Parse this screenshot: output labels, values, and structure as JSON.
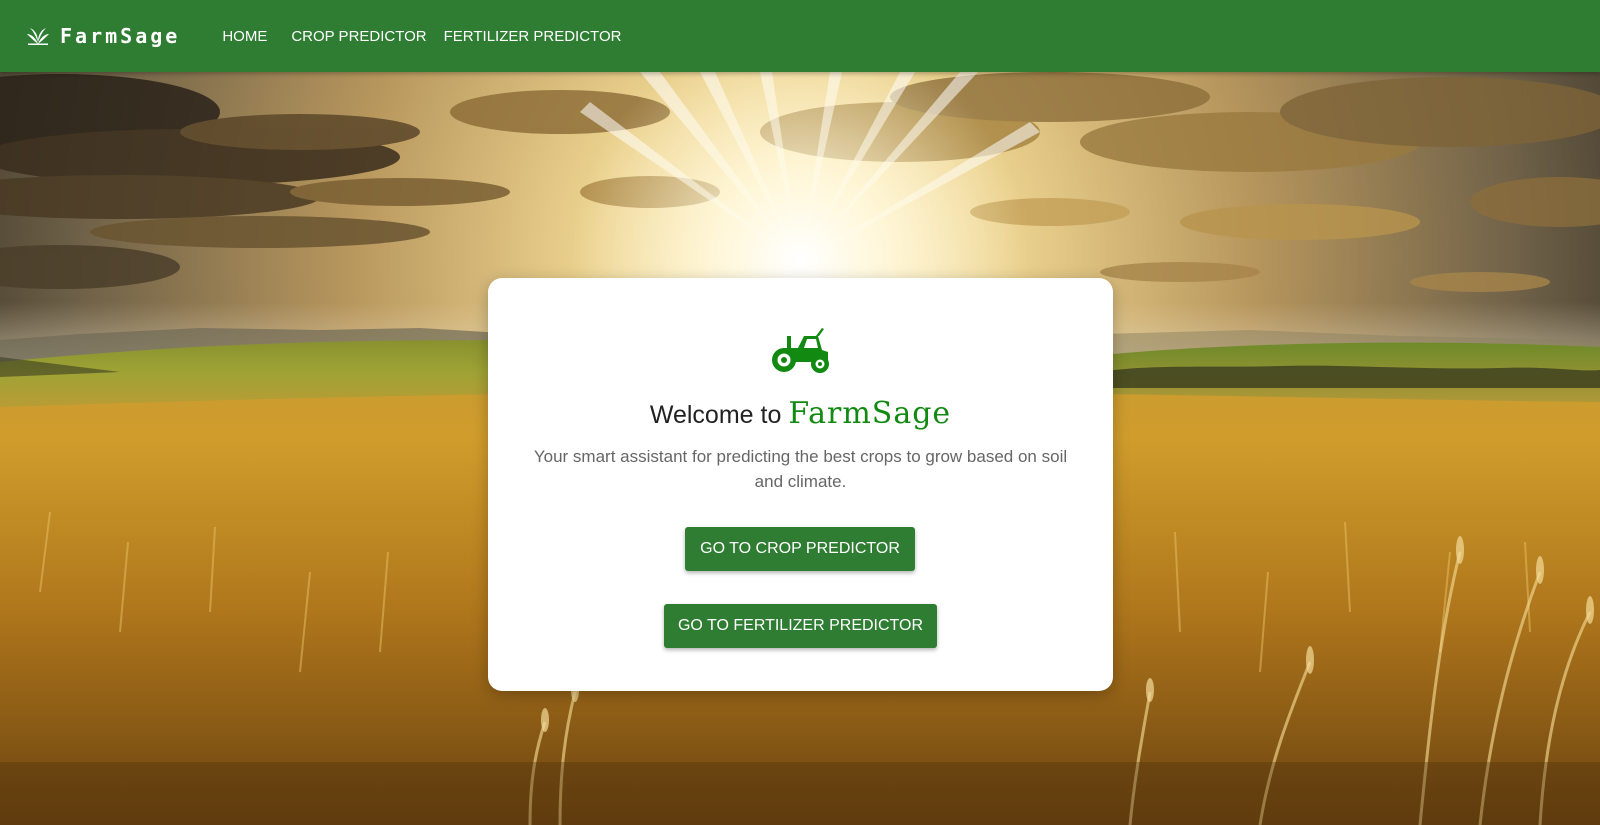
{
  "brand": {
    "name": "FarmSage",
    "icon": "leaf-sprout-icon"
  },
  "nav": {
    "items": [
      {
        "label": "HOME"
      },
      {
        "label": "CROP PREDICTOR"
      },
      {
        "label": "FERTILIZER PREDICTOR"
      }
    ]
  },
  "hero": {
    "card": {
      "icon": "tractor-icon",
      "welcome_prefix": "Welcome to",
      "welcome_brand": "FarmSage",
      "tagline": "Your smart assistant for predicting the best crops to grow based on soil and climate.",
      "crop_button_label": "GO TO CROP PREDICTOR",
      "fertilizer_button_label": "GO TO FERTILIZER PREDICTOR"
    }
  },
  "colors": {
    "primary": "#2e7d32",
    "brand_text": "#128a12",
    "card_bg": "#ffffff"
  }
}
